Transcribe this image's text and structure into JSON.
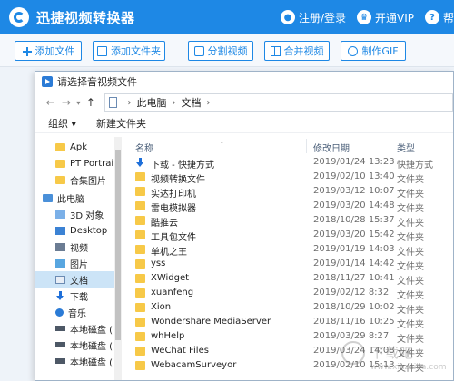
{
  "app": {
    "title": "迅捷视频转换器"
  },
  "header": {
    "login_label": "注册/登录",
    "vip_label": "开通VIP",
    "help_label": "帮"
  },
  "toolbar": {
    "add_file": "添加文件",
    "add_folder": "添加文件夹",
    "split_video": "分割视频",
    "merge_video": "合并视频",
    "make_gif": "制作GIF"
  },
  "dialog": {
    "title": "请选择音视频文件",
    "breadcrumb": [
      "此电脑",
      "文档"
    ],
    "commands": {
      "organize": "组织 ▾",
      "new_folder": "新建文件夹"
    },
    "tree": [
      {
        "label": "Apk",
        "icon": "folder-icon"
      },
      {
        "label": "PT Portrai",
        "icon": "folder-icon"
      },
      {
        "label": "合集图片",
        "icon": "folder-icon"
      },
      {
        "label": "此电脑",
        "icon": "computer-icon"
      },
      {
        "label": "3D 对象",
        "icon": "3d-objects-icon"
      },
      {
        "label": "Desktop",
        "icon": "desktop-icon"
      },
      {
        "label": "视频",
        "icon": "video-icon"
      },
      {
        "label": "图片",
        "icon": "picture-icon"
      },
      {
        "label": "文档",
        "icon": "document-icon",
        "selected": true
      },
      {
        "label": "下载",
        "icon": "download-icon"
      },
      {
        "label": "音乐",
        "icon": "music-icon"
      },
      {
        "label": "本地磁盘 (",
        "icon": "disk-icon"
      },
      {
        "label": "本地磁盘 (",
        "icon": "disk-icon"
      },
      {
        "label": "本地磁盘 (",
        "icon": "disk-icon"
      }
    ],
    "columns": {
      "name": "名称",
      "date": "修改日期",
      "type": "类型"
    },
    "files": [
      {
        "name": "下载 - 快捷方式",
        "date": "2019/01/24 13:23",
        "type": "快捷方式",
        "icon": "shortcut-icon"
      },
      {
        "name": "视频转换文件",
        "date": "2019/02/10 13:40",
        "type": "文件夹",
        "icon": "folder-icon"
      },
      {
        "name": "实达打印机",
        "date": "2019/03/12 10:07",
        "type": "文件夹",
        "icon": "folder-icon"
      },
      {
        "name": "雷电模拟器",
        "date": "2019/03/20 14:48",
        "type": "文件夹",
        "icon": "folder-icon"
      },
      {
        "name": "酷推云",
        "date": "2018/10/28 15:37",
        "type": "文件夹",
        "icon": "folder-icon"
      },
      {
        "name": "工具包文件",
        "date": "2019/03/20 15:42",
        "type": "文件夹",
        "icon": "folder-icon"
      },
      {
        "name": "单机之王",
        "date": "2019/01/19 14:03",
        "type": "文件夹",
        "icon": "folder-icon"
      },
      {
        "name": "yss",
        "date": "2019/01/14 14:42",
        "type": "文件夹",
        "icon": "folder-icon"
      },
      {
        "name": "XWidget",
        "date": "2018/11/27 10:41",
        "type": "文件夹",
        "icon": "folder-icon"
      },
      {
        "name": "xuanfeng",
        "date": "2019/02/12 8:32",
        "type": "文件夹",
        "icon": "folder-icon"
      },
      {
        "name": "Xion",
        "date": "2018/10/29 10:02",
        "type": "文件夹",
        "icon": "folder-icon"
      },
      {
        "name": "Wondershare MediaServer",
        "date": "2018/11/16 10:25",
        "type": "文件夹",
        "icon": "folder-icon"
      },
      {
        "name": "whHelp",
        "date": "2019/03/29 8:27",
        "type": "文件夹",
        "icon": "folder-icon"
      },
      {
        "name": "WeChat Files",
        "date": "2019/03/24 14:08",
        "type": "文件夹",
        "icon": "folder-icon"
      },
      {
        "name": "WebacamSurveyor",
        "date": "2019/02/10 15:13",
        "type": "文件夹",
        "icon": "folder-icon"
      }
    ]
  },
  "watermark": {
    "text": "下载吧",
    "url": "www.xiazaiba.com"
  },
  "colors": {
    "accent": "#1e88e5",
    "folder": "#f7c948",
    "selected_row": "#cce4f7"
  }
}
